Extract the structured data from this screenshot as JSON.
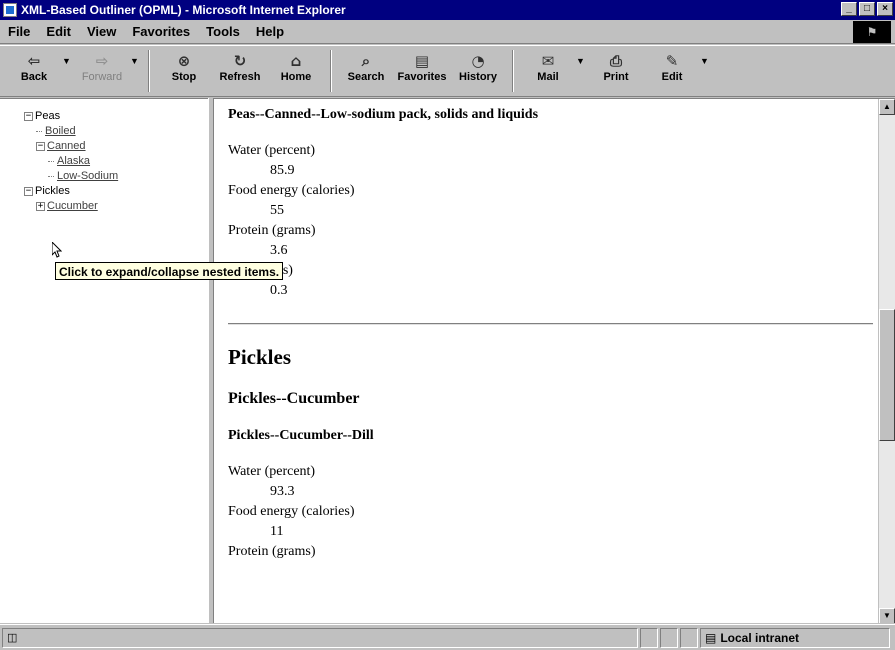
{
  "window": {
    "title": "XML-Based Outliner (OPML) - Microsoft Internet Explorer",
    "controls": [
      "_",
      "□",
      "×"
    ]
  },
  "menu": [
    "File",
    "Edit",
    "View",
    "Favorites",
    "Tools",
    "Help"
  ],
  "toolbar": [
    {
      "label": "Back",
      "icon": "back-arrow-icon",
      "glyph": "⇦",
      "disabled": false,
      "dropdown": true
    },
    {
      "label": "Forward",
      "icon": "forward-arrow-icon",
      "glyph": "⇨",
      "disabled": true,
      "dropdown": true
    },
    {
      "label": "Stop",
      "icon": "stop-icon",
      "glyph": "⊗",
      "disabled": false
    },
    {
      "label": "Refresh",
      "icon": "refresh-icon",
      "glyph": "↻",
      "disabled": false
    },
    {
      "label": "Home",
      "icon": "home-icon",
      "glyph": "⌂",
      "disabled": false
    },
    {
      "label": "Search",
      "icon": "search-icon",
      "glyph": "⌕",
      "disabled": false
    },
    {
      "label": "Favorites",
      "icon": "favorites-icon",
      "glyph": "▤",
      "disabled": false
    },
    {
      "label": "History",
      "icon": "history-icon",
      "glyph": "◔",
      "disabled": false
    },
    {
      "label": "Mail",
      "icon": "mail-icon",
      "glyph": "✉",
      "disabled": false,
      "dropdown": true
    },
    {
      "label": "Print",
      "icon": "print-icon",
      "glyph": "⎙",
      "disabled": false
    },
    {
      "label": "Edit",
      "icon": "edit-icon",
      "glyph": "✎",
      "disabled": false,
      "dropdown": true
    }
  ],
  "tree": [
    {
      "text": "Peas",
      "level": 0,
      "toggle": "−",
      "link": false
    },
    {
      "text": "Boiled",
      "level": 1,
      "toggle": null,
      "link": true
    },
    {
      "text": "Canned",
      "level": 1,
      "toggle": "−",
      "link": true
    },
    {
      "text": "Alaska",
      "level": 2,
      "toggle": null,
      "link": true
    },
    {
      "text": "Low-Sodium",
      "level": 2,
      "toggle": null,
      "link": true
    },
    {
      "text": "Pickles",
      "level": 0,
      "toggle": "−",
      "link": false
    },
    {
      "text": "Cucumber",
      "level": 1,
      "toggle": "+",
      "link": true
    }
  ],
  "tooltip": "Click to expand/collapse nested items.",
  "content": {
    "section1_heading": "Peas--Canned--Low-sodium pack, solids and liquids",
    "section1_stats": [
      {
        "label": "Water (percent)",
        "value": "85.9"
      },
      {
        "label": "Food energy (calories)",
        "value": "55"
      },
      {
        "label": "Protein (grams)",
        "value": "3.6"
      },
      {
        "label": "Fat (grams)",
        "value": "0.3"
      }
    ],
    "h1": "Pickles",
    "h2": "Pickles--Cucumber",
    "h3": "Pickles--Cucumber--Dill",
    "section2_stats": [
      {
        "label": "Water (percent)",
        "value": "93.3"
      },
      {
        "label": "Food energy (calories)",
        "value": "11"
      },
      {
        "label": "Protein (grams)",
        "value": ""
      }
    ]
  },
  "status": {
    "left_icon": "page-icon",
    "zone": "Local intranet"
  }
}
